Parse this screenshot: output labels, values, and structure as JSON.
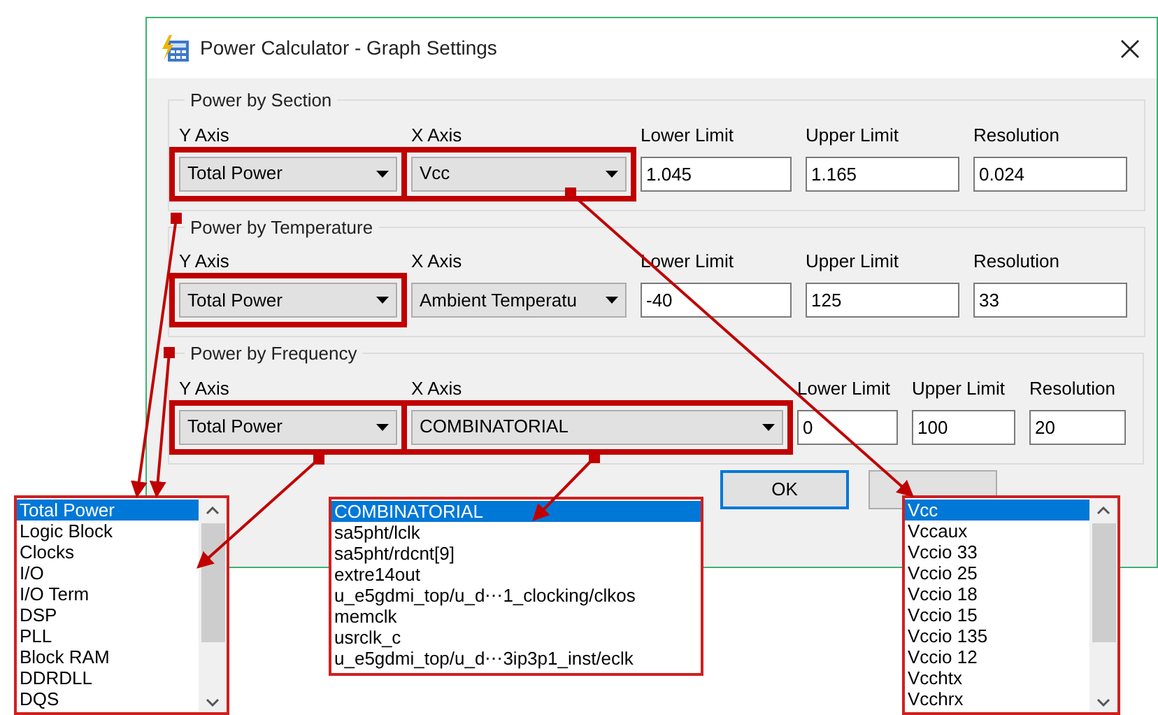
{
  "window": {
    "title": "Power Calculator - Graph Settings"
  },
  "sections": [
    {
      "title": "Power by Section",
      "kind": "standard",
      "y_axis": {
        "label": "Y Axis",
        "value": "Total Power",
        "highlighted": true
      },
      "x_axis": {
        "label": "X Axis",
        "value": "Vcc",
        "highlighted": true
      },
      "limits": [
        {
          "label": "Lower Limit",
          "value": "1.045"
        },
        {
          "label": "Upper Limit",
          "value": "1.165"
        },
        {
          "label": "Resolution",
          "value": "0.024"
        }
      ]
    },
    {
      "title": "Power by Temperature",
      "kind": "standard",
      "y_axis": {
        "label": "Y Axis",
        "value": "Total Power",
        "highlighted": true
      },
      "x_axis": {
        "label": "X Axis",
        "value": "Ambient Temperatu",
        "highlighted": false
      },
      "limits": [
        {
          "label": "Lower Limit",
          "value": "-40"
        },
        {
          "label": "Upper Limit",
          "value": "125"
        },
        {
          "label": "Resolution",
          "value": "33"
        }
      ]
    },
    {
      "title": "Power by Frequency",
      "kind": "wide",
      "y_axis": {
        "label": "Y Axis",
        "value": "Total Power",
        "highlighted": true
      },
      "x_axis": {
        "label": "X Axis",
        "value": "COMBINATORIAL",
        "highlighted": true
      },
      "limits": [
        {
          "label": "Lower Limit",
          "value": "0"
        },
        {
          "label": "Upper Limit",
          "value": "100"
        },
        {
          "label": "Resolution",
          "value": "20"
        }
      ]
    }
  ],
  "buttons": [
    {
      "label": "OK"
    }
  ],
  "dropdown_lists": [
    {
      "scrollable": true,
      "items": [
        {
          "label": "Total Power",
          "selected": true
        },
        {
          "label": "Logic Block",
          "selected": false
        },
        {
          "label": "Clocks",
          "selected": false
        },
        {
          "label": "I/O",
          "selected": false
        },
        {
          "label": "I/O Term",
          "selected": false
        },
        {
          "label": "DSP",
          "selected": false
        },
        {
          "label": "PLL",
          "selected": false
        },
        {
          "label": "Block RAM",
          "selected": false
        },
        {
          "label": "DDRDLL",
          "selected": false
        },
        {
          "label": "DQS",
          "selected": false
        }
      ]
    },
    {
      "scrollable": false,
      "items": [
        {
          "label": "COMBINATORIAL",
          "selected": true
        },
        {
          "label": "sa5pht/lclk",
          "selected": false
        },
        {
          "label": "sa5pht/rdcnt[9]",
          "selected": false
        },
        {
          "label": "extre14out",
          "selected": false
        },
        {
          "label": "u_e5gdmi_top/u_d⋯1_clocking/clkos",
          "selected": false
        },
        {
          "label": "memclk",
          "selected": false
        },
        {
          "label": "usrclk_c",
          "selected": false
        },
        {
          "label": "u_e5gdmi_top/u_d⋯3ip3p1_inst/eclk",
          "selected": false
        }
      ]
    },
    {
      "scrollable": true,
      "items": [
        {
          "label": "Vcc",
          "selected": true
        },
        {
          "label": "Vccaux",
          "selected": false
        },
        {
          "label": "Vccio 33",
          "selected": false
        },
        {
          "label": "Vccio 25",
          "selected": false
        },
        {
          "label": "Vccio 18",
          "selected": false
        },
        {
          "label": "Vccio 15",
          "selected": false
        },
        {
          "label": "Vccio 135",
          "selected": false
        },
        {
          "label": "Vccio 12",
          "selected": false
        },
        {
          "label": "Vcchtx",
          "selected": false
        },
        {
          "label": "Vcchrx",
          "selected": false
        }
      ]
    }
  ]
}
